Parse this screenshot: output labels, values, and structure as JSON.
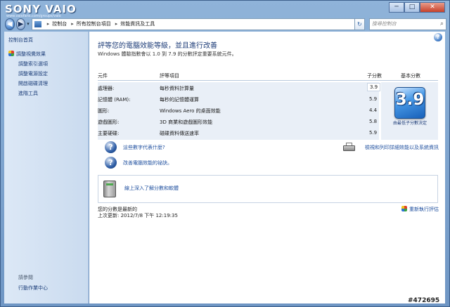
{
  "brand": {
    "name": "SONY VAIO",
    "tagline": "www.vaiofans.com/groups/vaio"
  },
  "window_controls": {
    "minimize": "─",
    "maximize": "□",
    "close": "✕"
  },
  "address_bar": {
    "crumbs": [
      "控制台",
      "所有控制台項目",
      "效能資訊及工具"
    ],
    "separator": "▸",
    "search_placeholder": "搜尋控制台"
  },
  "sidebar": {
    "items": [
      {
        "label": "控制台首頁"
      },
      {
        "label": "調整視覺效果"
      },
      {
        "label": "調整索引選項"
      },
      {
        "label": "調整電源設定"
      },
      {
        "label": "開啟磁碟清理"
      },
      {
        "label": "進階工具"
      }
    ],
    "see_also": "請參閱",
    "action_center": "行動作業中心"
  },
  "main": {
    "title": "評等您的電腦效能等級，並且進行改善",
    "subtitle": "Windows 體驗指數會以 1.0 到 7.9 的分數評定重要系統元件。",
    "headers": {
      "component": "元件",
      "rated": "評等項目",
      "subscore": "子分數",
      "basescore": "基本分數"
    },
    "rows": [
      {
        "component": "處理器:",
        "rated": "每秒資料計算量",
        "subscore": "3.9"
      },
      {
        "component": "記憶體 (RAM):",
        "rated": "每秒的記憶體運算",
        "subscore": "5.9"
      },
      {
        "component": "圖形:",
        "rated": "Windows Aero 的桌面效能",
        "subscore": "4.4"
      },
      {
        "component": "遊戲圖形:",
        "rated": "3D 商業和遊戲圖形效能",
        "subscore": "5.8"
      },
      {
        "component": "主要硬碟:",
        "rated": "磁碟資料傳送速率",
        "subscore": "5.9"
      }
    ],
    "base_score": "3.9",
    "base_caption": "由最低子分數決定",
    "links": {
      "what_numbers_mean": "這些數字代表什麼?",
      "print_details": "檢視和列印詳細效能以及系統資訊",
      "tips": "改善電腦效能的祕訣。",
      "learn_more": "線上深入了解分數和軟體"
    },
    "status": "您的分數是最新的",
    "last_update": "上次更新: 2012/7/8 下午 12:19:35",
    "rerun": "重新執行評估"
  },
  "watermark": "#472695"
}
